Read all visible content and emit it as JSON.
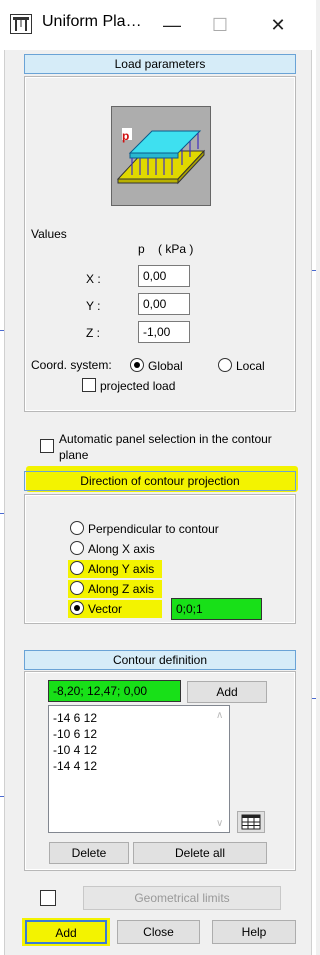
{
  "window": {
    "title": "Uniform Pla…",
    "minimize_glyph": "—",
    "maximize_glyph": "☐",
    "close_glyph": "✕"
  },
  "load_parameters": {
    "header": "Load parameters",
    "preview_badge": "p",
    "values_label": "Values",
    "unit_label": "p    ( kPa )",
    "x_label": "X :",
    "x_value": "0,00",
    "y_label": "Y :",
    "y_value": "0,00",
    "z_label": "Z :",
    "z_value": "-1,00",
    "coord_label": "Coord. system:",
    "global_label": "Global",
    "local_label": "Local",
    "projected_label": "projected load"
  },
  "auto_panel_label_line1": "Automatic panel selection in the contour",
  "auto_panel_label_line2": "plane",
  "direction": {
    "header": "Direction of contour projection",
    "options": [
      {
        "label": "Perpendicular to contour"
      },
      {
        "label": "Along X axis"
      },
      {
        "label": "Along Y axis"
      },
      {
        "label": "Along Z axis"
      },
      {
        "label": "Vector"
      }
    ],
    "selected": "Vector",
    "vector_value": "0;0;1"
  },
  "contour": {
    "header": "Contour definition",
    "point_input": "-8,20; 12,47; 0,00",
    "add_label": "Add",
    "points": [
      "-14 6 12",
      "-10 6 12",
      "-10 4 12",
      "-14 4 12"
    ],
    "delete_label": "Delete",
    "delete_all_label": "Delete all"
  },
  "footer": {
    "geometrical_limits_label": "Geometrical limits",
    "add_label": "Add",
    "close_label": "Close",
    "help_label": "Help"
  },
  "colors": {
    "header_bg": "#d6ecf8",
    "highlight_yellow": "#f3f300",
    "highlight_green": "#18e018",
    "preview_slab": "#3ee0f0",
    "preview_base": "#e0d800"
  }
}
